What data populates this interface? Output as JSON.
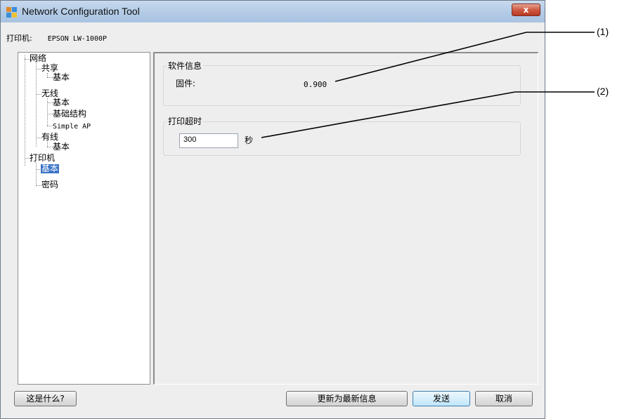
{
  "window": {
    "title": "Network Configuration Tool",
    "close_symbol": "x",
    "icon": "app-icon"
  },
  "printer": {
    "label": "打印机:",
    "name": "EPSON LW-1000P"
  },
  "tree": {
    "items": [
      {
        "label": "网络"
      },
      {
        "label": "共享"
      },
      {
        "label": "基本"
      },
      {
        "label": "无线"
      },
      {
        "label": "基本"
      },
      {
        "label": "基础结构"
      },
      {
        "label": "Simple AP"
      },
      {
        "label": "有线"
      },
      {
        "label": "基本"
      },
      {
        "label": "打印机"
      },
      {
        "label": "基本",
        "selected": true
      },
      {
        "label": "密码"
      }
    ]
  },
  "software_info": {
    "title": "软件信息",
    "firmware_label": "固件:",
    "firmware_value": "0.900"
  },
  "print_timeout": {
    "title": "打印超时",
    "value": "300",
    "unit": "秒"
  },
  "buttons": {
    "help": "这是什么?",
    "update": "更新为最新信息",
    "send": "发送",
    "cancel": "取消"
  },
  "callouts": [
    "(1)",
    "(2)"
  ],
  "colors": {
    "selection": "#3a73c6",
    "close_button": "#c9533c",
    "titlebar": "#b9cfe8"
  }
}
